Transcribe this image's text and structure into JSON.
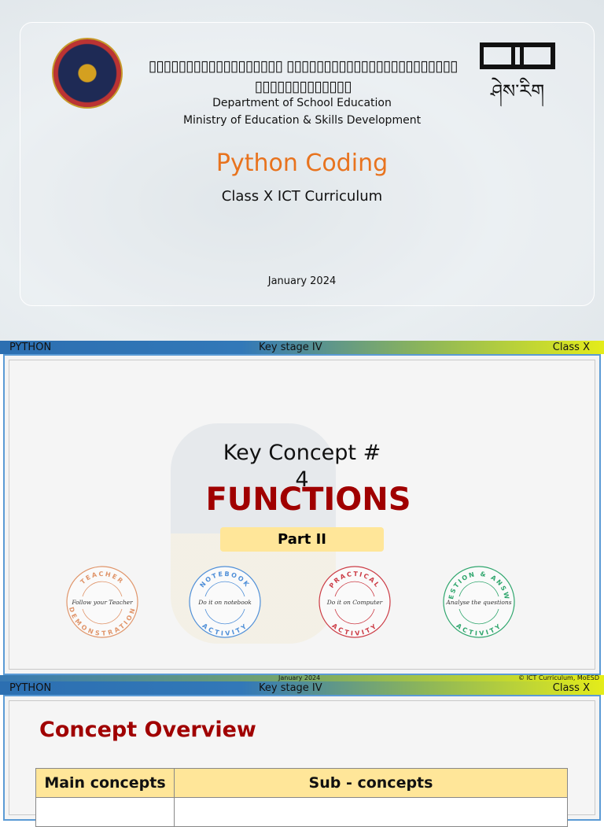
{
  "slide1": {
    "tofu_line1": "▯▯▯▯▯▯▯▯▯▯▯▯▯▯▯▯▯▯ ▯▯▯▯▯▯▯▯▯▯▯▯▯▯▯▯▯▯▯▯▯▯▯",
    "tofu_line2": "▯▯▯▯▯▯▯▯▯▯▯▯▯",
    "department": "Department of School Education",
    "ministry": "Ministry of Education & Skills Development",
    "title": "Python Coding",
    "subtitle": "Class X ICT Curriculum",
    "date": "January  2024",
    "logo_text": "ཤེས་རིག"
  },
  "header": {
    "left": "PYTHON",
    "center": "Key stage IV",
    "right": "Class X"
  },
  "slide2": {
    "key_concept": "Key Concept #",
    "number": "4",
    "title": "FUNCTIONS",
    "part": "Part II",
    "badges": [
      {
        "top": "TEACHER",
        "middle": "Follow your Teacher",
        "bottom": "DEMONSTRATION",
        "color": "#e0956a"
      },
      {
        "top": "NOTEBOOK",
        "middle": "Do it on notebook",
        "bottom": "ACTIVITY",
        "color": "#4f8fd8"
      },
      {
        "top": "PRACTICAL",
        "middle": "Do it on Computer",
        "bottom": "ACTIVITY",
        "color": "#cc3b45"
      },
      {
        "top": "QUESTION & ANSWER",
        "middle": "Analyse the questions",
        "bottom": "ACTIVITY",
        "color": "#2fa66d"
      }
    ]
  },
  "footer": {
    "date": "January 2024",
    "copyright": "© ICT Curriculum, MoESD"
  },
  "slide3": {
    "title": "Concept Overview",
    "table": {
      "headers": [
        "Main concepts",
        "Sub - concepts"
      ]
    }
  }
}
